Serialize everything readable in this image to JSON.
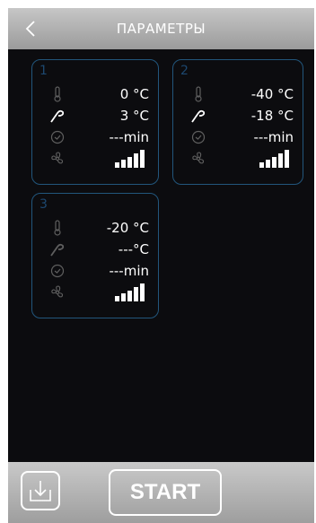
{
  "header": {
    "title": "ПАРАМЕТРЫ"
  },
  "cards": [
    {
      "number": "1",
      "temperature": "0 °C",
      "probe_temperature": "3 °C",
      "time": "---min",
      "fan_level": 5
    },
    {
      "number": "2",
      "temperature": "-40 °C",
      "probe_temperature": "-18 °C",
      "time": "---min",
      "fan_level": 5
    },
    {
      "number": "3",
      "temperature": "-20 °C",
      "probe_temperature": "---°C",
      "time": "---min",
      "fan_level": 5
    }
  ],
  "footer": {
    "start_label": "START"
  },
  "colors": {
    "card_border": "#22567c",
    "card_number": "#1d4870",
    "icon": "#5f5f5f",
    "background": "#0c0c0f"
  },
  "icons": [
    "back-chevron-icon",
    "thermometer-icon",
    "probe-icon",
    "clock-icon",
    "fan-icon",
    "signal-bars-icon",
    "download-icon"
  ]
}
